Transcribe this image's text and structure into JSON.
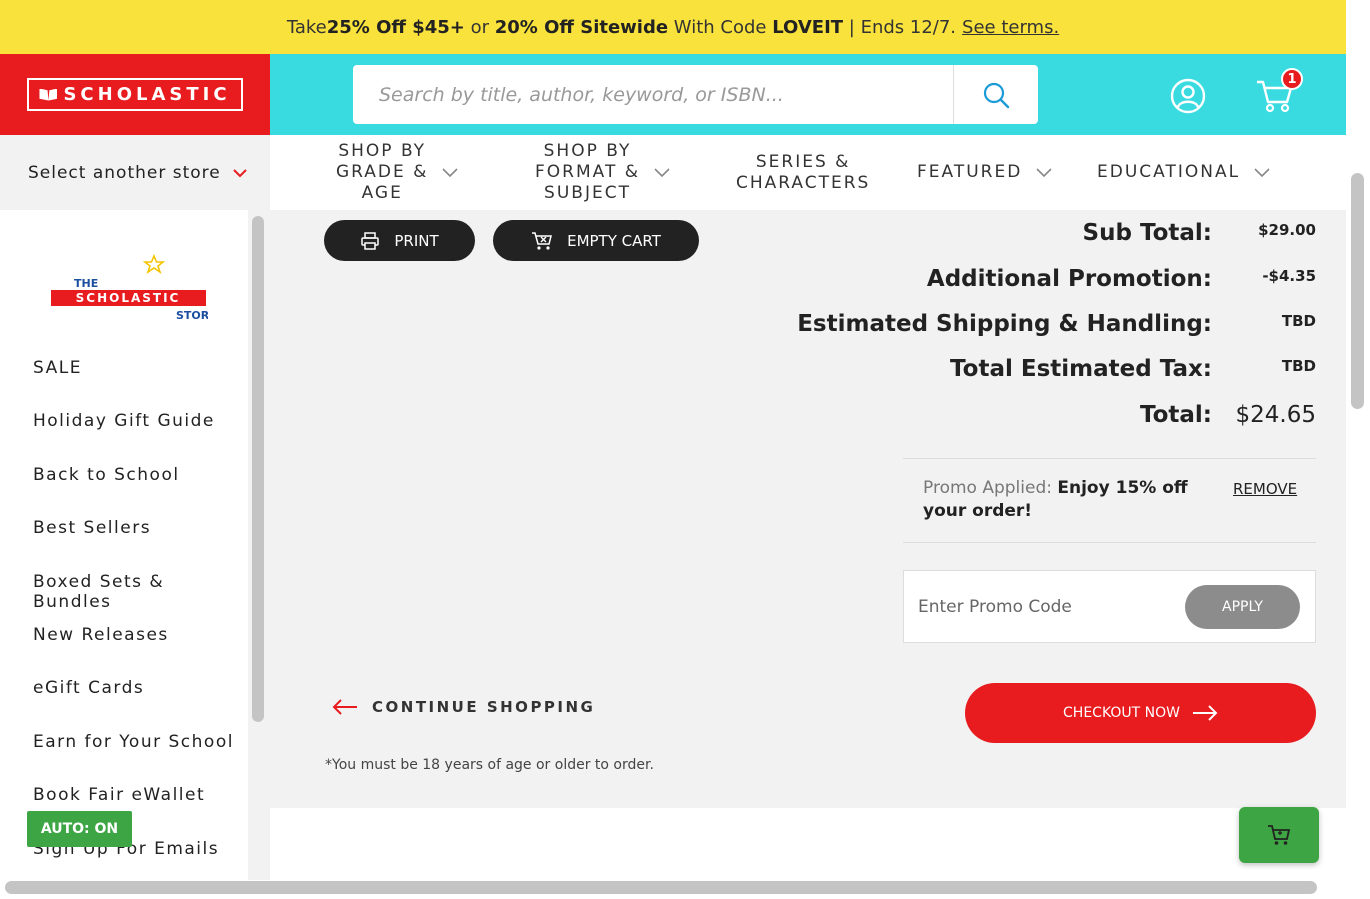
{
  "promo_bar": {
    "t1": "Take ",
    "b1": "25% Off $45+",
    "t2": " or ",
    "b2": "20% Off Sitewide",
    "t3": " With Code ",
    "b3": "LOVEIT",
    "t4": " | Ends 12/7.",
    "terms": "See terms."
  },
  "header": {
    "logo_text": "SCHOLASTIC",
    "search_placeholder": "Search by title, author, keyword, or ISBN...",
    "cart_count": "1"
  },
  "store_select": {
    "label": "Select another store"
  },
  "nav": {
    "grade_l1": "SHOP BY",
    "grade_l2": "GRADE &",
    "grade_l3": "AGE",
    "format_l1": "SHOP BY",
    "format_l2": "FORMAT &",
    "format_l3": "SUBJECT",
    "series_l1": "SERIES &",
    "series_l2": "CHARACTERS",
    "featured": "FEATURED",
    "educational": "EDUCATIONAL"
  },
  "store_logo": {
    "the": "THE",
    "name": "SCHOLASTIC",
    "store": "STORE"
  },
  "sidebar": {
    "items": [
      "SALE",
      "Holiday Gift Guide",
      "Back to School",
      "Best Sellers",
      "Boxed Sets & Bundles",
      "New Releases",
      "eGift Cards",
      "Earn for Your School",
      "Book Fair eWallet",
      "Sign Up For Emails"
    ]
  },
  "actions": {
    "print": "PRINT",
    "empty_cart": "EMPTY CART"
  },
  "summary": {
    "sub_total_label": "Sub Total:",
    "sub_total_value": "$29.00",
    "promotion_label": "Additional Promotion:",
    "promotion_value": "-$4.35",
    "shipping_label": "Estimated Shipping & Handling:",
    "shipping_value": "TBD",
    "tax_label": "Total Estimated Tax:",
    "tax_value": "TBD",
    "total_label": "Total:",
    "total_value": "$24.65"
  },
  "promo": {
    "applied_label": "Promo Applied:",
    "applied_text": "Enjoy 15% off your order!",
    "remove": "REMOVE",
    "input_placeholder": "Enter Promo Code",
    "apply": "APPLY"
  },
  "footer_actions": {
    "continue": "CONTINUE SHOPPING",
    "checkout": "CHECKOUT NOW",
    "age_note": "*You must be 18 years of age or older to order."
  },
  "auto_badge": "AUTO: ON",
  "colors": {
    "brand_red": "#e81b1f",
    "cyan": "#3adbe0",
    "promo_yellow": "#f9e23c",
    "green": "#3da544"
  }
}
